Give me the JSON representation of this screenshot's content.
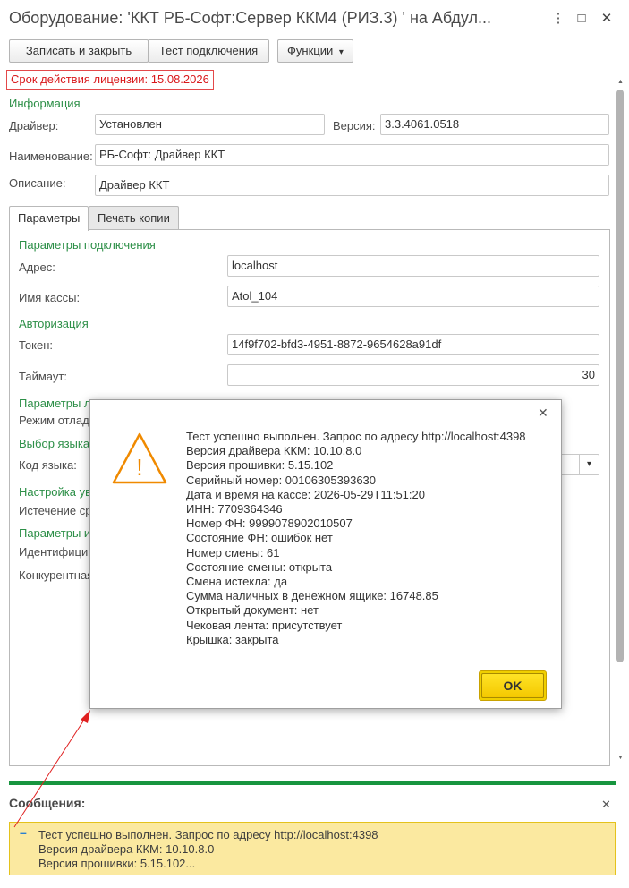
{
  "window": {
    "title": "Оборудование: 'ККТ РБ-Софт:Сервер ККМ4 (РИЗ.3) ' на Абдул...",
    "more_icon": "⋮",
    "maximize_icon": "□",
    "close_icon": "✕"
  },
  "toolbar": {
    "save_close": "Записать и закрыть",
    "test_connection": "Тест подключения",
    "functions": "Функции",
    "functions_arrow": "▾"
  },
  "license": {
    "text": "Срок действия лицензии: 15.08.2026"
  },
  "info": {
    "section_title": "Информация",
    "driver_label": "Драйвер:",
    "driver_value": "Установлен",
    "version_label": "Версия:",
    "version_value": "3.3.4061.0518",
    "name_label": "Наименование:",
    "name_value": "РБ-Софт: Драйвер ККТ",
    "description_label": "Описание:",
    "description_value": "Драйвер ККТ"
  },
  "tabs": [
    {
      "label": "Параметры"
    },
    {
      "label": "Печать копии"
    }
  ],
  "params": {
    "connection_title": "Параметры подключения",
    "address_label": "Адрес:",
    "address_value": "localhost",
    "cashbox_label": "Имя кассы:",
    "cashbox_value": "Atol_104",
    "auth_title": "Авторизация",
    "token_label": "Токен:",
    "token_value": "14f9f702-bfd3-4951-8872-9654628a91df",
    "timeout_label": "Таймаут:",
    "timeout_value": "30",
    "log_title": "Параметры л",
    "debug_label": "Режим отлад",
    "lang_title": "Выбор языка",
    "lang_code_label": "Код языка:",
    "notify_title": "Настройка ув",
    "expiry_label": "Истечение ср",
    "id_title": "Параметры и",
    "identifier_label": "Идентифици",
    "competitive_label": "Конкурентная",
    "dropdown_arrow": "▾"
  },
  "dialog": {
    "close_icon": "✕",
    "warning_icon": "!",
    "lines": [
      "Тест успешно выполнен. Запрос по адресу http://localhost:4398",
      "Версия драйвера ККМ: 10.10.8.0",
      "Версия прошивки: 5.15.102",
      "Серийный номер: 00106305393630",
      "Дата и время на кассе: 2026-05-29T11:51:20",
      "ИНН: 7709364346",
      "Номер ФН: 9999078902010507",
      "Состояние ФН: ошибок нет",
      "Номер смены: 61",
      "Состояние смены: открыта",
      "Смена истекла: да",
      "Сумма наличных в денежном ящике: 16748.85",
      "Открытый документ: нет",
      "Чековая лента: присутствует",
      "Крышка: закрыта"
    ],
    "ok_label": "OK"
  },
  "messages": {
    "title": "Сообщения:",
    "close_icon": "✕",
    "dash": "–",
    "lines": [
      "Тест успешно выполнен. Запрос по адресу http://localhost:4398",
      "Версия драйвера ККМ: 10.10.8.0",
      "Версия прошивки: 5.15.102..."
    ]
  },
  "colors": {
    "accent_green": "#2c8f47",
    "license_red": "#d9181b",
    "ok_yellow": "#f4c800",
    "warning_orange": "#f08a00",
    "message_bg": "#fbe9a0",
    "arrow_red": "#e02020"
  }
}
